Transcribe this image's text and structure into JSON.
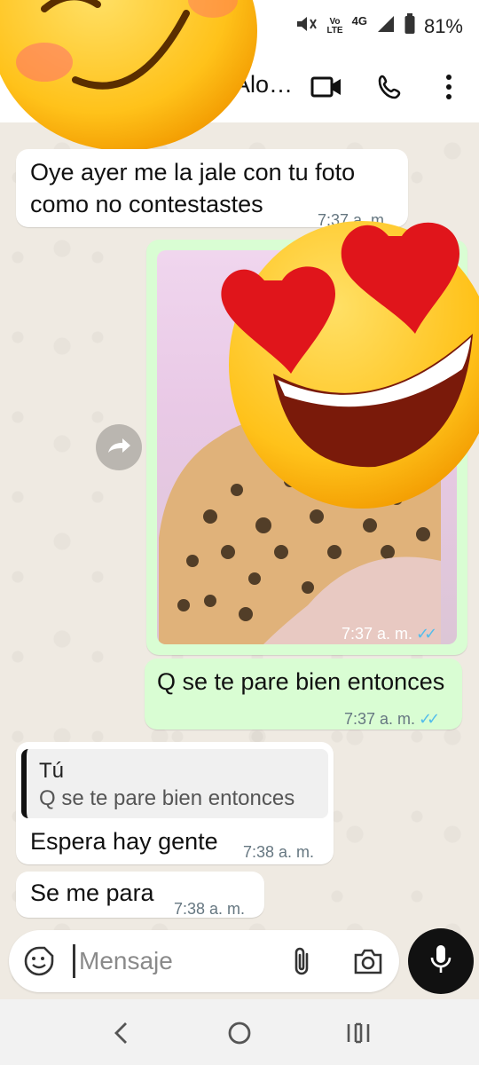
{
  "status_bar": {
    "lte_label": "Vo\nLTE",
    "network_label": "4G",
    "battery_text": "81%"
  },
  "header": {
    "contact_name": "Alo…",
    "icons": [
      "video-call-icon",
      "phone-icon",
      "more-options-icon"
    ]
  },
  "messages": [
    {
      "direction": "in",
      "text_line1": "Oye ayer me la jale con tu foto",
      "text_line2": "como no contestastes",
      "time": "7:37 a. m."
    },
    {
      "direction": "out",
      "type": "photo",
      "time": "7:37 a. m.",
      "ticks": "✓✓"
    },
    {
      "direction": "out",
      "text": "Q se te pare bien entonces",
      "time": "7:37 a. m.",
      "ticks": "✓✓"
    },
    {
      "direction": "in",
      "quote_author": "Tú",
      "quote_text": "Q se te pare bien entonces",
      "text": "Espera hay gente",
      "time": "7:38 a. m."
    },
    {
      "direction": "in",
      "text": "Se me para",
      "time": "7:38 a. m."
    }
  ],
  "input": {
    "placeholder": "Mensaje",
    "icons": [
      "emoji-sticker-icon",
      "attach-icon",
      "camera-icon",
      "mic-icon"
    ]
  },
  "colors": {
    "outgoing_bubble": "#d9fdd3",
    "incoming_bubble": "#ffffff",
    "read_ticks": "#53bdeb",
    "wallpaper": "#efeae2"
  }
}
